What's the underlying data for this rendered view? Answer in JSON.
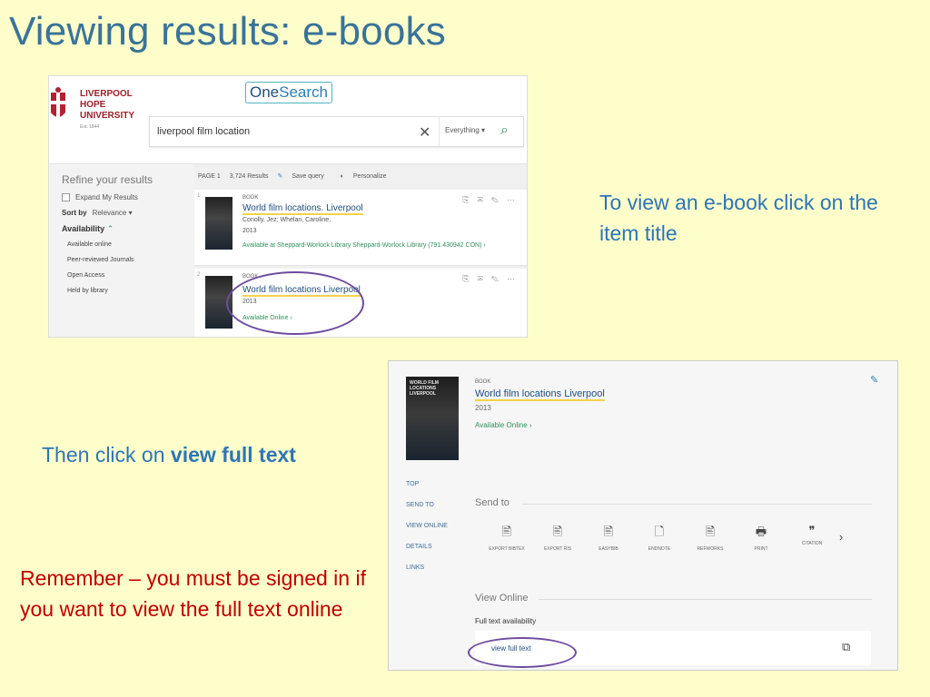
{
  "slide": {
    "title": "Viewing results: e-books",
    "note_title_hint": "To view an e-book click on the item title",
    "note_fulltext_prefix": "Then click on ",
    "note_fulltext_bold": "view full text",
    "note_signin": "Remember – you must be signed in if you want to view the full text online"
  },
  "search_screen": {
    "university": [
      "LIVERPOOL",
      "HOPE",
      "UNIVERSITY"
    ],
    "established": "Est. 1844",
    "brand_one": "One",
    "brand_search": "Search",
    "query": "liverpool film location",
    "clear_symbol": "✕",
    "scope": "Everything ▾",
    "refine_title": "Refine your results",
    "expand_label": "Expand My Results",
    "sort_label": "Sort by",
    "sort_value": "Relevance ▾",
    "availability_label": "Availability",
    "availability_options": [
      "Available online",
      "Peer-reviewed Journals",
      "Open Access",
      "Held by library"
    ],
    "page_label": "PAGE 1",
    "results_count": "3,724 Results",
    "save_query": "Save query",
    "personalize": "Personalize",
    "results": [
      {
        "num": "1",
        "type": "BOOK",
        "title": "World film locations. Liverpool",
        "authors": "Conolly, Jez; Whelan, Caroline,",
        "year": "2013",
        "availability": "Available at Sheppard-Worlock Library  Sheppard-Worlock Library (791.430942 CON) ›"
      },
      {
        "num": "2",
        "type": "BOOK",
        "title": "World film locations Liverpool",
        "year": "2013",
        "availability": "Available Online ›"
      }
    ]
  },
  "record_screen": {
    "cover_text": "WORLD FILM LOCATIONS LIVERPOOL",
    "type": "BOOK",
    "title": "World film locations Liverpool",
    "year": "2013",
    "availability": "Available Online ›",
    "nav": [
      "TOP",
      "SEND TO",
      "VIEW ONLINE",
      "DETAILS",
      "LINKS"
    ],
    "send_to_heading": "Send to",
    "tools": [
      "EXPORT BIBTEX",
      "EXPORT RIS",
      "EASYBIB",
      "ENDNOTE",
      "REFWORKS",
      "PRINT",
      "CITATION"
    ],
    "tool_icons": [
      "🖹",
      "🖹",
      "🖹",
      "🗋",
      "🖹",
      "🖶",
      "❞"
    ],
    "next_symbol": "›",
    "view_online_heading": "View Online",
    "full_text_availability": "Full text availability",
    "view_full_text": "view full text",
    "external_symbol": "⧉"
  },
  "colors": {
    "background": "#fefecb",
    "title": "#3a7399",
    "note_blue": "#2e75b6",
    "note_red": "#c00000",
    "highlight_ellipse": "#6d4c9f"
  }
}
